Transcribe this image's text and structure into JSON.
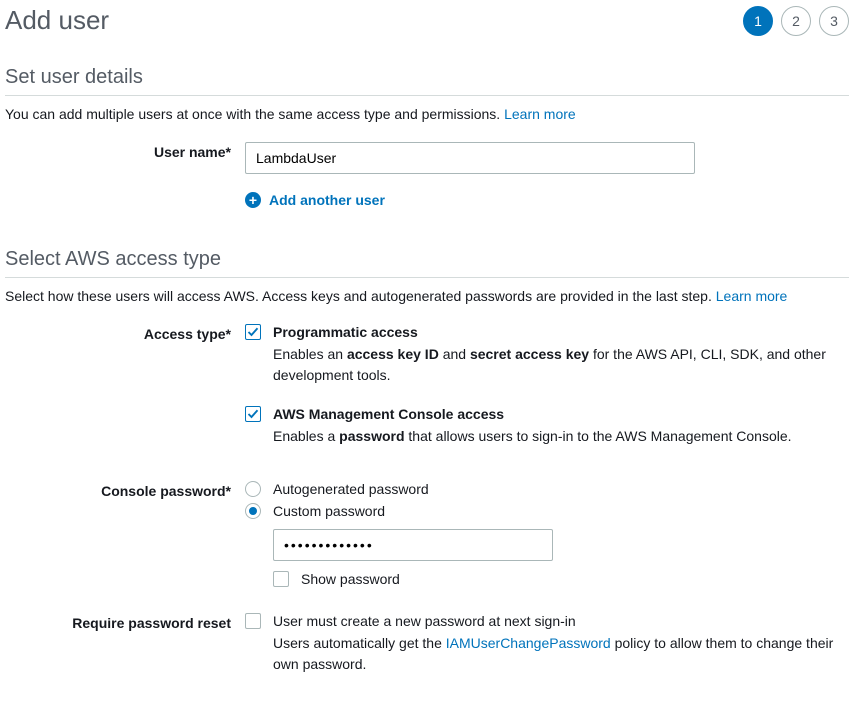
{
  "page": {
    "title": "Add user"
  },
  "stepper": {
    "steps": [
      "1",
      "2",
      "3"
    ],
    "active": 1
  },
  "section1": {
    "title": "Set user details",
    "desc_prefix": "You can add multiple users at once with the same access type and permissions. ",
    "learn_more": "Learn more",
    "username_label": "User name*",
    "username_value": "LambdaUser",
    "add_another": "Add another user"
  },
  "section2": {
    "title": "Select AWS access type",
    "desc_prefix": "Select how these users will access AWS. Access keys and autogenerated passwords are provided in the last step. ",
    "learn_more": "Learn more",
    "access_type_label": "Access type*",
    "programmatic": {
      "title": "Programmatic access",
      "desc_1": "Enables an ",
      "desc_2": "access key ID",
      "desc_3": " and ",
      "desc_4": "secret access key",
      "desc_5": " for the AWS API, CLI, SDK, and other development tools.",
      "checked": true
    },
    "console": {
      "title": "AWS Management Console access",
      "desc_1": "Enables a ",
      "desc_2": "password",
      "desc_3": " that allows users to sign-in to the AWS Management Console.",
      "checked": true
    },
    "console_password_label": "Console password*",
    "autogen_label": "Autogenerated password",
    "custom_label": "Custom password",
    "password_value": "•••••••••••••",
    "show_password_label": "Show password",
    "require_reset_label": "Require password reset",
    "reset_title": "User must create a new password at next sign-in",
    "reset_desc_1": "Users automatically get the ",
    "reset_policy": "IAMUserChangePassword",
    "reset_desc_2": " policy to allow them to change their own password."
  }
}
